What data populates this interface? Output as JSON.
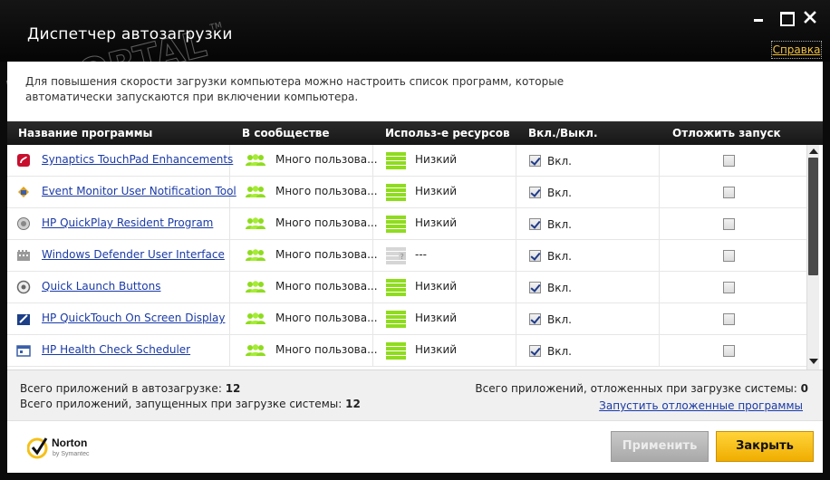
{
  "window": {
    "title": "Диспетчер автозагрузки",
    "help_label": "Справка"
  },
  "watermark": {
    "text": "PORTAL",
    "tm": "TM"
  },
  "description": "Для повышения скорости загрузки компьютера можно настроить список программ, которые автоматически запускаются при включении компьютера.",
  "table": {
    "headers": {
      "name": "Название программы",
      "community": "В сообществе",
      "resources": "Использ-е ресурсов",
      "onoff": "Вкл./Выкл.",
      "delay": "Отложить запуск"
    },
    "rows": [
      {
        "name": "Synaptics TouchPad Enhancements",
        "icon": "synaptics-icon",
        "community": "Много пользова...",
        "resource": "Низкий",
        "enabled": true,
        "enabled_label": "Вкл.",
        "delayed": false
      },
      {
        "name": "Event Monitor User Notification Tool",
        "icon": "event-monitor-icon",
        "community": "Много пользова...",
        "resource": "Низкий",
        "enabled": true,
        "enabled_label": "Вкл.",
        "delayed": false
      },
      {
        "name": "HP QuickPlay Resident Program",
        "icon": "quickplay-icon",
        "community": "Много пользова...",
        "resource": "Низкий",
        "enabled": true,
        "enabled_label": "Вкл.",
        "delayed": false
      },
      {
        "name": "Windows Defender User Interface",
        "icon": "windows-defender-icon",
        "community": "Много пользова...",
        "resource": "---",
        "enabled": true,
        "enabled_label": "Вкл.",
        "delayed": false
      },
      {
        "name": "Quick Launch Buttons",
        "icon": "quick-launch-icon",
        "community": "Много пользова...",
        "resource": "Низкий",
        "enabled": true,
        "enabled_label": "Вкл.",
        "delayed": false
      },
      {
        "name": "HP QuickTouch On Screen Display",
        "icon": "quicktouch-icon",
        "community": "Много пользова...",
        "resource": "Низкий",
        "enabled": true,
        "enabled_label": "Вкл.",
        "delayed": false
      },
      {
        "name": "HP Health Check Scheduler",
        "icon": "health-check-icon",
        "community": "Много пользова...",
        "resource": "Низкий",
        "enabled": true,
        "enabled_label": "Вкл.",
        "delayed": false
      }
    ]
  },
  "summary": {
    "total_label": "Всего приложений в автозагрузке:",
    "total_value": "12",
    "started_label": "Всего приложений, запущенных при загрузке системы:",
    "started_value": "12",
    "delayed_label": "Всего приложений, отложенных при загрузке системы:",
    "delayed_value": "0",
    "run_delayed_link": "Запустить отложенные программы"
  },
  "footer": {
    "brand": "Norton",
    "brand_sub": "by Symantec",
    "apply_label": "Применить",
    "close_label": "Закрыть"
  },
  "colors": {
    "accent_yellow": "#f5c018",
    "link_blue": "#1a3aa6",
    "resource_green": "#8fdc1e",
    "community_green": "#8fdc1e"
  }
}
